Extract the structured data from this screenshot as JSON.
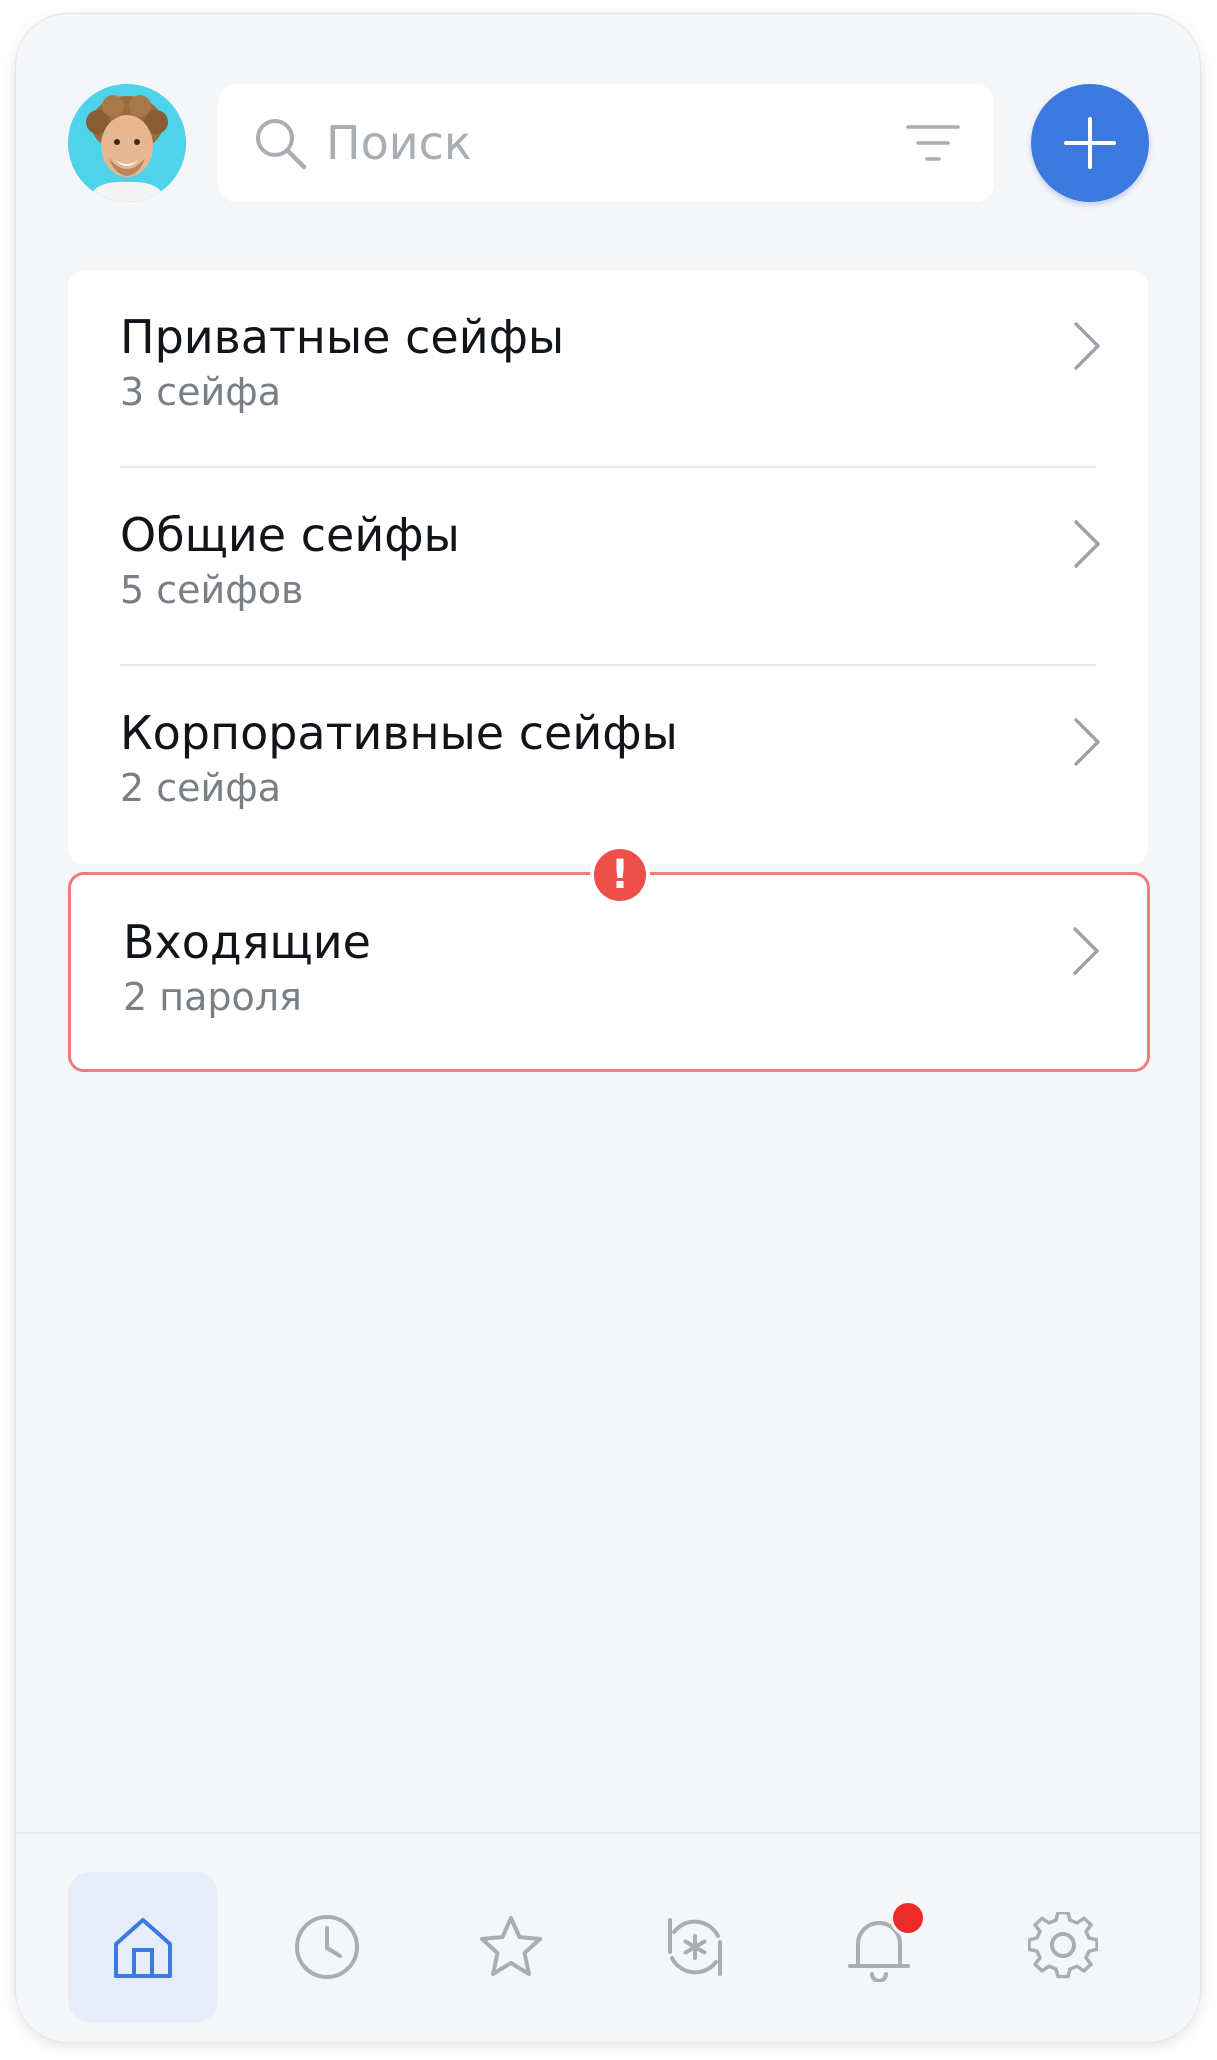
{
  "header": {
    "search_placeholder": "Поиск"
  },
  "vaults": [
    {
      "title": "Приватные сейфы",
      "subtitle": "3 сейфа"
    },
    {
      "title": "Общие сейфы",
      "subtitle": "5 сейфов"
    },
    {
      "title": "Корпоративные сейфы",
      "subtitle": "2 сейфа"
    }
  ],
  "inbox": {
    "title": "Входящие",
    "subtitle": "2 пароля",
    "badge": "!"
  },
  "nav": {
    "items": [
      {
        "icon": "home-icon",
        "active": true
      },
      {
        "icon": "clock-icon",
        "active": false
      },
      {
        "icon": "star-icon",
        "active": false
      },
      {
        "icon": "password-generator-icon",
        "active": false
      },
      {
        "icon": "bell-icon",
        "active": false,
        "notification": true
      },
      {
        "icon": "gear-icon",
        "active": false
      }
    ]
  },
  "colors": {
    "accent": "#3d7ae0",
    "alert": "#ee4f4b",
    "alert_border": "#ee7d7b",
    "background": "#f5f6f8"
  }
}
